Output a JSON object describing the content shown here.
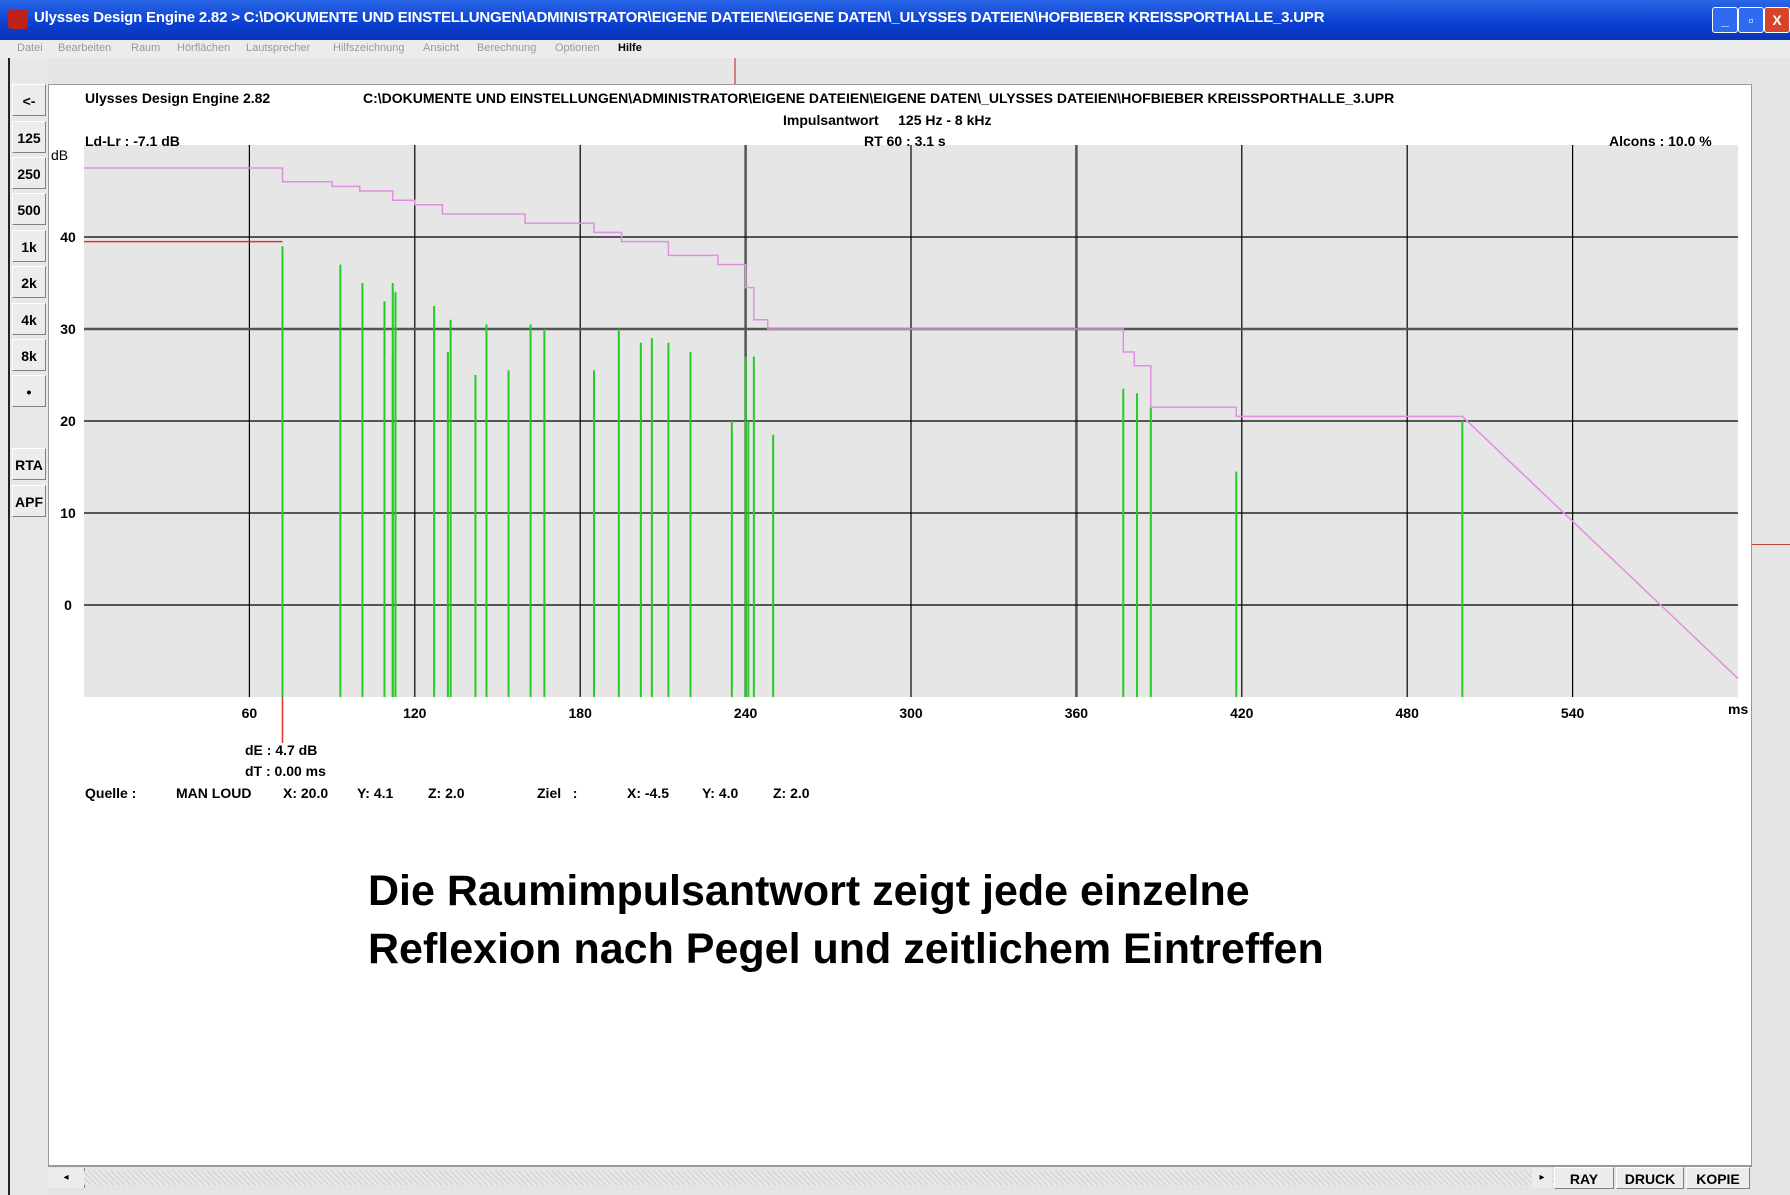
{
  "window": {
    "title": "Ulysses Design Engine 2.82 > C:\\DOKUMENTE UND EINSTELLUNGEN\\ADMINISTRATOR\\EIGENE DATEIEN\\EIGENE DATEN\\_ULYSSES DATEIEN\\HOFBIEBER KREISSPORTHALLE_3.UPR",
    "minimize": "_",
    "maximize": "▫",
    "close": "X"
  },
  "menu": {
    "items": [
      "Datei",
      "Bearbeiten",
      "Raum",
      "Hörflächen",
      "Lautsprecher",
      "Hilfszeichnung",
      "Ansicht",
      "Berechnung",
      "Optionen",
      "Hilfe"
    ]
  },
  "sidebar": {
    "buttons": [
      "<-",
      "125",
      "250",
      "500",
      "1k",
      "2k",
      "4k",
      "8k",
      "•",
      "RTA",
      "APF"
    ]
  },
  "header": {
    "app": "Ulysses Design Engine 2.82",
    "path": "C:\\DOKUMENTE UND EINSTELLUNGEN\\ADMINISTRATOR\\EIGENE DATEIEN\\EIGENE DATEN\\_ULYSSES DATEIEN\\HOFBIEBER KREISSPORTHALLE_3.UPR",
    "mode": "Impulsantwort     125 Hz - 8 kHz",
    "ldlr": "Ld-Lr : -7.1 dB",
    "rt60": "RT 60 : 3.1 s",
    "alcons": "Alcons : 10.0 %"
  },
  "cursor": {
    "de": "dE : 4.7 dB",
    "dt": "dT : 0.00 ms"
  },
  "source": {
    "label": "Quelle :",
    "name": "MAN LOUD",
    "x": "X: 20.0",
    "y": "Y: 4.1",
    "z": "Z: 2.0"
  },
  "target": {
    "label": "Ziel   :",
    "x": "X: -4.5",
    "y": "Y: 4.0",
    "z": "Z: 2.0"
  },
  "caption": {
    "line1": "Die Raumimpulsantwort zeigt jede einzelne",
    "line2": "Reflexion nach Pegel und zeitlichem Eintreffen"
  },
  "bottom": {
    "ray": "RAY",
    "druck": "DRUCK",
    "kopie": "KOPIE"
  },
  "colors": {
    "reflection": "#22cc22",
    "decay_curve": "#e090e0",
    "direct_level": "#e03030",
    "plot_background": "#e6e6e6"
  },
  "chart_data": {
    "type": "bar",
    "ylabel": "dB",
    "xunit": "ms",
    "xlim": [
      0,
      600
    ],
    "ylim": [
      -10,
      50
    ],
    "xticks": [
      60,
      120,
      180,
      240,
      300,
      360,
      420,
      480,
      540
    ],
    "yticks": [
      0,
      10,
      20,
      30,
      40
    ],
    "direct_level": 39.5,
    "cursor_time": 72,
    "reflections": [
      [
        72,
        39
      ],
      [
        93,
        37
      ],
      [
        101,
        35
      ],
      [
        109,
        33
      ],
      [
        112,
        35
      ],
      [
        112,
        27
      ],
      [
        113,
        34
      ],
      [
        127,
        32.5
      ],
      [
        132,
        27.5
      ],
      [
        133,
        31
      ],
      [
        142,
        25
      ],
      [
        146,
        30.5
      ],
      [
        154,
        25.5
      ],
      [
        162,
        30.5
      ],
      [
        167,
        30
      ],
      [
        185,
        25.5
      ],
      [
        194,
        30
      ],
      [
        202,
        28.5
      ],
      [
        206,
        29
      ],
      [
        212,
        28.5
      ],
      [
        220,
        27.5
      ],
      [
        235,
        20
      ],
      [
        240,
        27
      ],
      [
        241,
        20
      ],
      [
        243,
        27
      ],
      [
        250,
        18.5
      ],
      [
        377,
        23.5
      ],
      [
        382,
        23
      ],
      [
        387,
        21.5
      ],
      [
        418,
        14.5
      ],
      [
        500,
        20
      ]
    ],
    "decay_curve": [
      [
        0,
        47.5
      ],
      [
        72,
        47.5
      ],
      [
        72,
        46
      ],
      [
        90,
        46
      ],
      [
        90,
        45.5
      ],
      [
        100,
        45.5
      ],
      [
        100,
        45
      ],
      [
        112,
        45
      ],
      [
        112,
        44
      ],
      [
        120,
        44
      ],
      [
        120,
        43.5
      ],
      [
        130,
        43.5
      ],
      [
        130,
        42.5
      ],
      [
        160,
        42.5
      ],
      [
        160,
        41.5
      ],
      [
        185,
        41.5
      ],
      [
        185,
        40.5
      ],
      [
        195,
        40.5
      ],
      [
        195,
        39.5
      ],
      [
        212,
        39.5
      ],
      [
        212,
        38
      ],
      [
        230,
        38
      ],
      [
        230,
        37
      ],
      [
        240,
        37
      ],
      [
        240,
        34.5
      ],
      [
        243,
        34.5
      ],
      [
        243,
        31
      ],
      [
        248,
        31
      ],
      [
        248,
        30
      ],
      [
        377,
        30
      ],
      [
        377,
        27.5
      ],
      [
        381,
        27.5
      ],
      [
        381,
        26
      ],
      [
        387,
        26
      ],
      [
        387,
        21.5
      ],
      [
        418,
        21.5
      ],
      [
        418,
        20.5
      ],
      [
        500,
        20.5
      ],
      [
        600,
        -8
      ]
    ]
  }
}
